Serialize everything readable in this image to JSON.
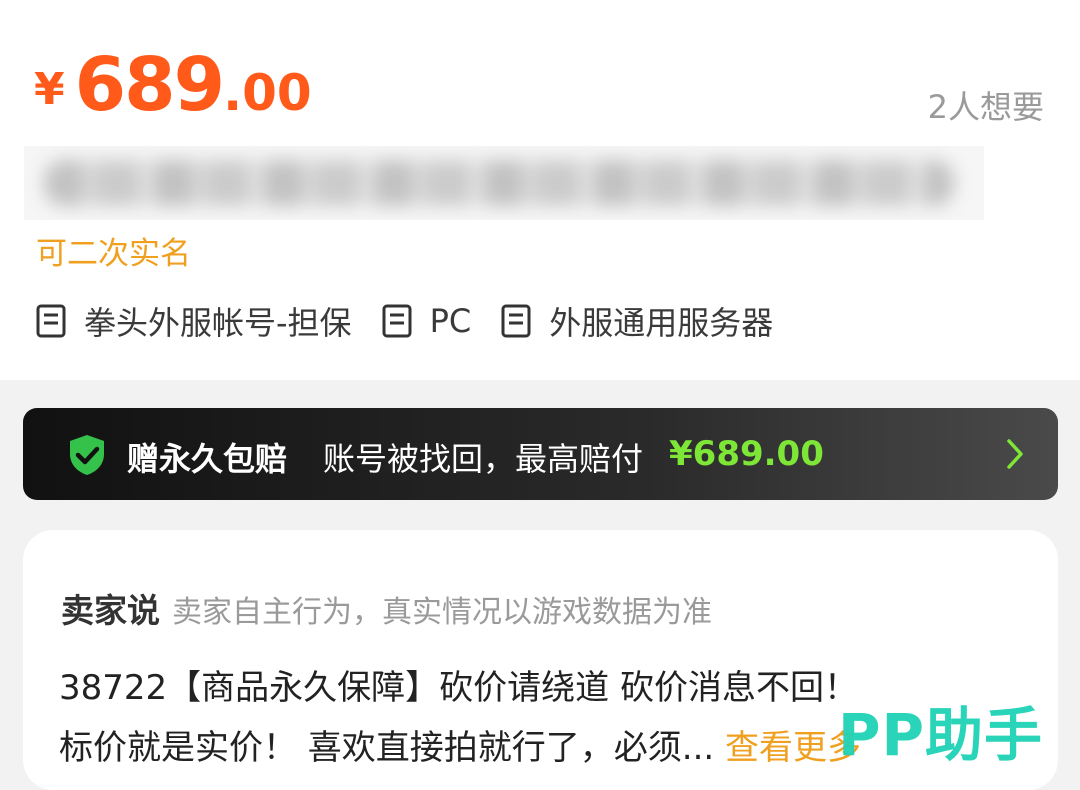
{
  "price": {
    "symbol": "¥",
    "integer": "689",
    "decimal": ".00"
  },
  "want_count": "2人想要",
  "realname_tag": "可二次实名",
  "tags": [
    {
      "icon": "list-doc-icon",
      "label": "拳头外服帐号-担保"
    },
    {
      "icon": "list-doc-icon",
      "label": "PC"
    },
    {
      "icon": "list-doc-icon",
      "label": "外服通用服务器"
    }
  ],
  "guarantee": {
    "icon": "shield-check-icon",
    "title": "赠永久包赔",
    "desc": "账号被找回，最高赔付",
    "amount": "¥689.00",
    "amount_color": "#7ee637"
  },
  "seller": {
    "title": "卖家说",
    "note": "卖家自主行为，真实情况以游戏数据为准",
    "line1": "38722【商品永久保障】砍价请绕道 砍价消息不回！",
    "line2": "标价就是实价！ 喜欢直接拍就行了，必须...",
    "more": "查看更多"
  },
  "watermark": "PP助手",
  "colors": {
    "price": "#ff5a1a",
    "accent": "#f0a020",
    "watermark": "#1fd2b6"
  }
}
